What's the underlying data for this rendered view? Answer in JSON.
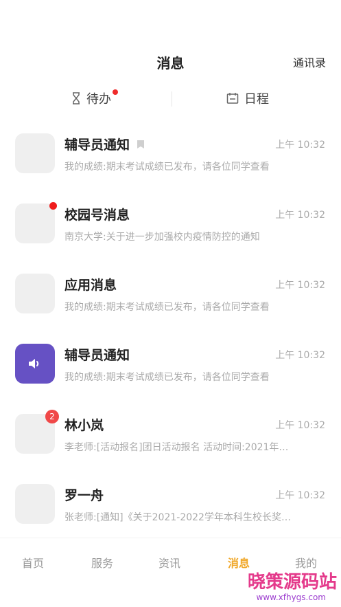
{
  "header": {
    "title": "消息",
    "contacts": "通讯录"
  },
  "tabs": [
    {
      "label": "待办",
      "icon": "hourglass-icon",
      "has_dot": true
    },
    {
      "label": "日程",
      "icon": "calendar-icon",
      "has_dot": false
    }
  ],
  "messages": [
    {
      "title": "辅导员通知",
      "time": "上午 10:32",
      "preview": "我的成绩:期末考试成绩已发布，请各位同学查看",
      "bookmark": true,
      "dot": false,
      "count": "",
      "avatar": "placeholder"
    },
    {
      "title": "校园号消息",
      "time": "上午 10:32",
      "preview": "南京大学:关于进一步加强校内疫情防控的通知",
      "bookmark": false,
      "dot": true,
      "count": "",
      "avatar": "placeholder"
    },
    {
      "title": "应用消息",
      "time": "上午 10:32",
      "preview": "我的成绩:期末考试成绩已发布，请各位同学查看",
      "bookmark": false,
      "dot": false,
      "count": "",
      "avatar": "placeholder"
    },
    {
      "title": "辅导员通知",
      "time": "上午 10:32",
      "preview": "我的成绩:期末考试成绩已发布，请各位同学查看",
      "bookmark": false,
      "dot": false,
      "count": "",
      "avatar": "speaker-icon"
    },
    {
      "title": "林小岚",
      "time": "上午 10:32",
      "preview": "李老师:[活动报名]团日活动报名 活动时间:2021年…",
      "bookmark": false,
      "dot": false,
      "count": "2",
      "avatar": "placeholder"
    },
    {
      "title": "罗一舟",
      "time": "上午 10:32",
      "preview": "张老师:[通知]《关于2021-2022学年本科生校长奖…",
      "bookmark": false,
      "dot": false,
      "count": "",
      "avatar": "placeholder"
    }
  ],
  "nav": {
    "items": [
      "首页",
      "服务",
      "资讯",
      "消息",
      "我的"
    ],
    "active": "消息"
  },
  "watermark": {
    "text": "晓策源码站",
    "url": "www.xfhygs.com"
  },
  "colors": {
    "accent": "#f0a82a",
    "badge_red": "#ef1c1c",
    "purple_avatar": "#6651c4"
  }
}
